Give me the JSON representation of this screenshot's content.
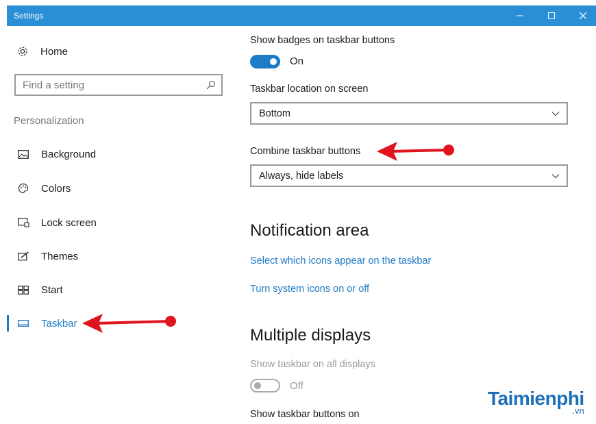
{
  "window": {
    "title": "Settings"
  },
  "sidebar": {
    "home_label": "Home",
    "search_placeholder": "Find a setting",
    "section_label": "Personalization",
    "items": [
      {
        "label": "Background",
        "icon": "picture-icon"
      },
      {
        "label": "Colors",
        "icon": "palette-icon"
      },
      {
        "label": "Lock screen",
        "icon": "lock-screen-icon"
      },
      {
        "label": "Themes",
        "icon": "brush-icon"
      },
      {
        "label": "Start",
        "icon": "start-icon"
      },
      {
        "label": "Taskbar",
        "icon": "taskbar-icon",
        "active": true
      }
    ]
  },
  "main": {
    "badges": {
      "label": "Show badges on taskbar buttons",
      "state": "On"
    },
    "location": {
      "label": "Taskbar location on screen",
      "value": "Bottom"
    },
    "combine": {
      "label": "Combine taskbar buttons",
      "value": "Always, hide labels"
    },
    "notification": {
      "heading": "Notification area",
      "link1": "Select which icons appear on the taskbar",
      "link2": "Turn system icons on or off"
    },
    "multiple": {
      "heading": "Multiple displays",
      "show_all_label": "Show taskbar on all displays",
      "show_all_state": "Off",
      "buttons_on_label": "Show taskbar buttons on"
    }
  },
  "watermark": {
    "brand": "Taimienphi",
    "tld": ".vn"
  },
  "colors": {
    "accent": "#1e7bc8",
    "titlebar": "#2b8fd6",
    "annotation": "#e0141e"
  }
}
